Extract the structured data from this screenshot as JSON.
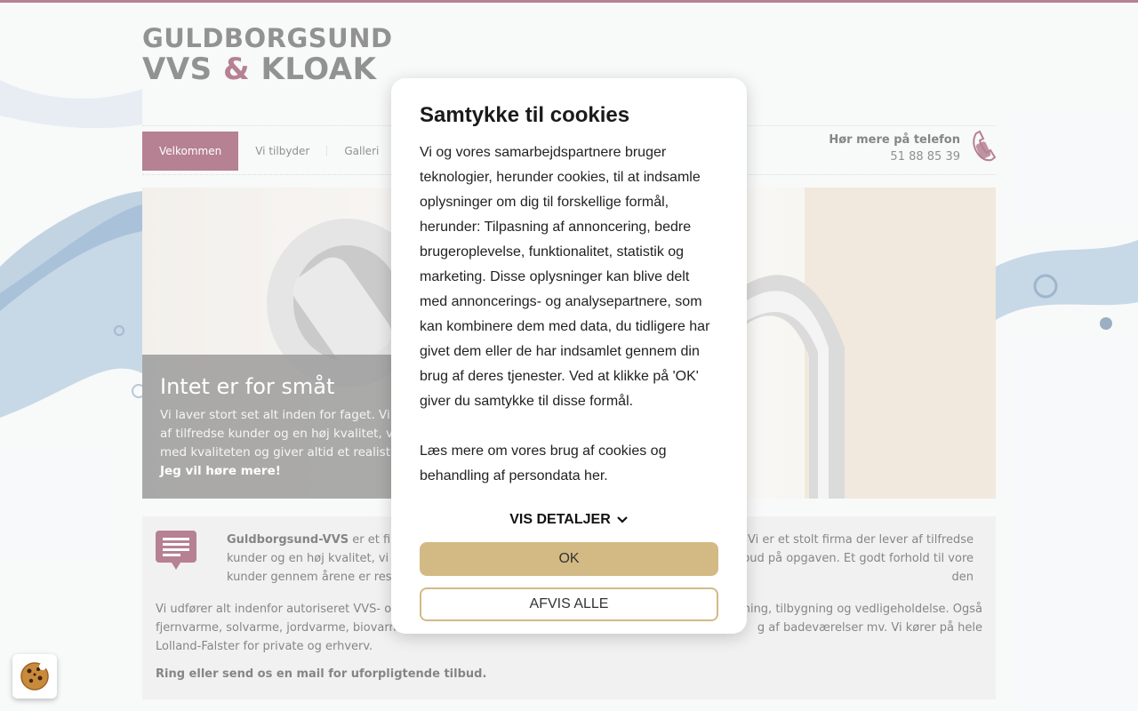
{
  "brand": {
    "line1": "GULDBORGSUND",
    "line2_a": "VVS",
    "line2_amp": "&",
    "line2_b": "KLOAK",
    "accent_color": "#7a1a3a"
  },
  "nav": {
    "items": [
      {
        "label": "Velkommen",
        "active": true
      },
      {
        "label": "Vi tilbyder",
        "active": false
      },
      {
        "label": "Galleri",
        "active": false
      }
    ]
  },
  "phone": {
    "title": "Hør mere på telefon",
    "number": "51 88 85 39",
    "icon": "phone-icon"
  },
  "hero": {
    "title": "Intet er for småt",
    "text_lines": [
      "Vi laver stort set alt inden for faget. Vi",
      "af tilfredse kunder og en høj kvalitet, v",
      "med kvaliteten og giver altid et realisti"
    ],
    "more_link": "Jeg vil høre mere!"
  },
  "content": {
    "intro_bold": "Guldborgsund-VVS",
    "intro_left_lines": [
      " er et firm",
      "kunder og en høj kvalitet, vi ga",
      "kunder gennem årene er resu"
    ],
    "intro_right_lines": [
      "Vi er et stolt firma der lever af tilfredse",
      "bud på opgaven. Et godt forhold til vore",
      "den"
    ],
    "para2_left_lines": [
      "Vi udfører alt indenfor autoriseret VVS- og",
      "fjernvarme, solvarme, jordvarme, biovarm",
      "Lolland-Falster for private og erhverv."
    ],
    "para2_right_lines": [
      "ning, tilbygning og vedligeholdelse. Også",
      "g af badeværelser mv. Vi kører på hele",
      ""
    ],
    "cta": "Ring eller send os en mail for uforpligtende tilbud."
  },
  "cookie_modal": {
    "title": "Samtykke til cookies",
    "body": "Vi og vores samarbejdspartnere bruger teknologier, herunder cookies, til at indsamle oplysninger om dig til forskellige formål, herunder: Tilpasning af annoncering, bedre brugeroplevelse, funktionalitet, statistik og marketing. Disse oplysninger kan blive delt med annoncerings- og analysepartnere, som kan kombinere dem med data, du tidligere har givet dem eller de har indsamlet gennem din brug af deres tjenester. Ved at klikke på 'OK' giver du samtykke til disse formål.",
    "read_more": "Læs mere om vores brug af cookies og behandling af persondata her.",
    "details_label": "VIS DETALJER",
    "ok_label": "OK",
    "reject_label": "AFVIS ALLE",
    "button_color": "#d3ba85"
  },
  "cookie_button": {
    "icon": "cookie-icon"
  }
}
